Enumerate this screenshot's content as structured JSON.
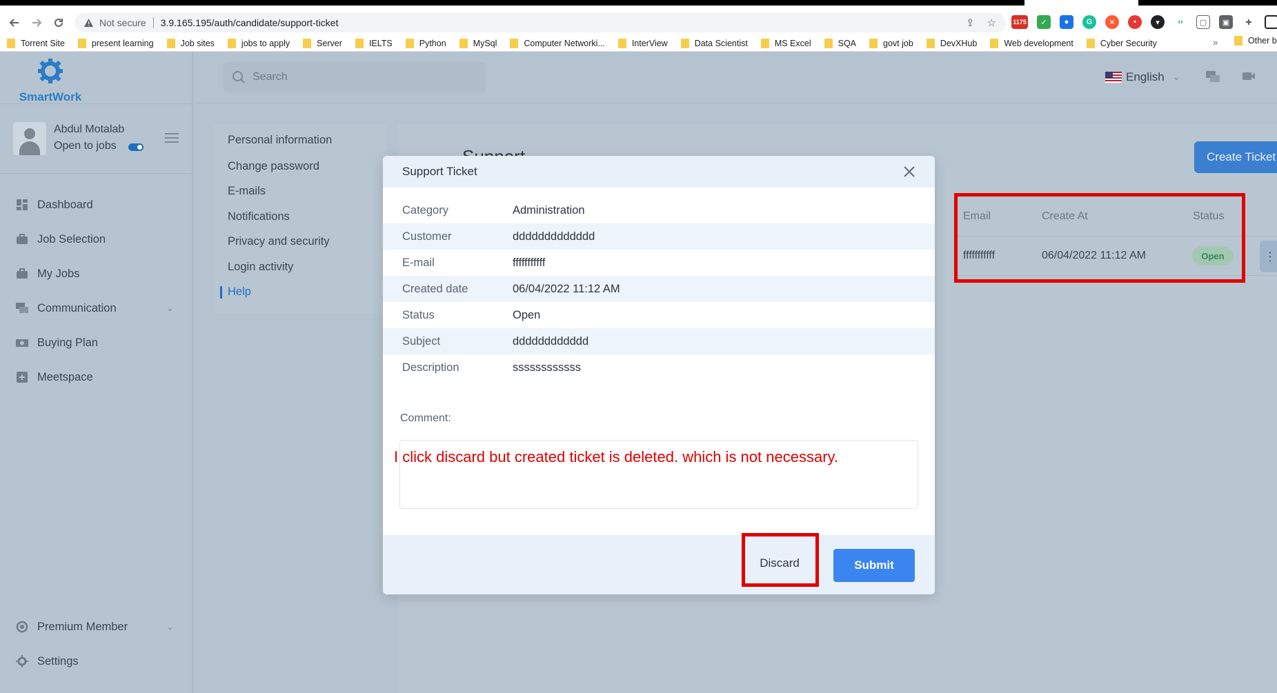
{
  "browser": {
    "not_secure": "Not secure",
    "url": "3.9.165.195/auth/candidate/support-ticket",
    "bookmarks": [
      "Torrent Site",
      "present learning",
      "Job sites",
      "jobs to apply",
      "Server",
      "IELTS",
      "Python",
      "MySql",
      "Computer Networki...",
      "InterView",
      "Data Scientist",
      "MS Excel",
      "SQA",
      "govt job",
      "DevXHub",
      "Web development",
      "Cyber Security"
    ],
    "more": "»",
    "other_bookmarks": "Other b",
    "ext_badge": "1175"
  },
  "sidebar": {
    "brand": "SmartWork",
    "user_name": "Abdul Motalab",
    "user_status": "Open to jobs",
    "menu": [
      {
        "label": "Dashboard",
        "icon": "dashboard-icon"
      },
      {
        "label": "Job Selection",
        "icon": "briefcase-icon"
      },
      {
        "label": "My Jobs",
        "icon": "briefcase-icon"
      },
      {
        "label": "Communication",
        "icon": "chat-icon"
      },
      {
        "label": "Buying Plan",
        "icon": "cash-icon"
      },
      {
        "label": "Meetspace",
        "icon": "plus-square-icon"
      }
    ],
    "premium": "Premium Member",
    "settings": "Settings"
  },
  "header": {
    "search_placeholder": "Search",
    "language": "English"
  },
  "settings_menu": [
    "Personal information",
    "Change password",
    "E-mails",
    "Notifications",
    "Privacy and security",
    "Login activity",
    "Help"
  ],
  "support": {
    "title": "Support",
    "create_button": "Create Ticket",
    "columns": [
      "Email",
      "Create At",
      "Status"
    ],
    "row": {
      "email": "fffffffffff",
      "created": "06/04/2022 11:12 AM",
      "status": "Open"
    }
  },
  "modal": {
    "title": "Support Ticket",
    "fields": [
      {
        "label": "Category",
        "value": "Administration"
      },
      {
        "label": "Customer",
        "value": "ddddddddddddd"
      },
      {
        "label": "E-mail",
        "value": "fffffffffff"
      },
      {
        "label": "Created date",
        "value": "06/04/2022 11:12 AM"
      },
      {
        "label": "Status",
        "value": "Open"
      },
      {
        "label": "Subject",
        "value": "dddddddddddd"
      },
      {
        "label": "Description",
        "value": "ssssssssssss"
      }
    ],
    "comment_label": "Comment:",
    "annotation": "I click discard but created ticket is deleted. which is not necessary.",
    "discard": "Discard",
    "submit": "Submit"
  },
  "colors": {
    "accent": "#3a85f0",
    "brand": "#2a7cc7",
    "annotation_red": "#e00000",
    "overlay": "#b4c3cf"
  }
}
